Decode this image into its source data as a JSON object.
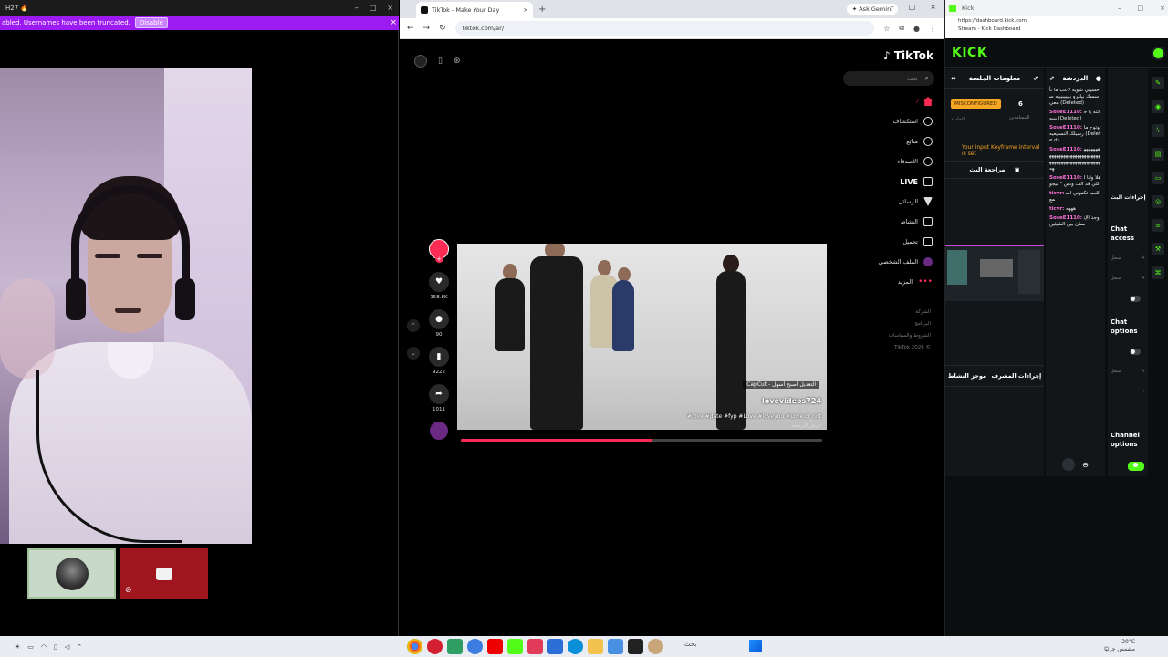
{
  "left_window": {
    "title": "H27 🔥",
    "banner_message": "abled. Usernames have been truncated.",
    "banner_button": "Disable",
    "banner_close": "×"
  },
  "browser": {
    "tab_title": "TikTok - Make Your Day",
    "tab_close": "×",
    "new_tab": "+",
    "gemini_label": "✦ Ask Gemini",
    "url": "tiktok.com/ar/",
    "window_controls": [
      "–",
      "□",
      "×"
    ]
  },
  "tiktok": {
    "logo": "♪ TikTok",
    "search_placeholder": "بحث",
    "nav": [
      {
        "label": "",
        "icon": "home"
      },
      {
        "label": "استكشاف",
        "icon": "compass"
      },
      {
        "label": "متابَع",
        "icon": "user"
      },
      {
        "label": "الأصدقاء",
        "icon": "friends"
      },
      {
        "label": "LIVE",
        "icon": "live"
      },
      {
        "label": "الرسائل",
        "icon": "messages"
      },
      {
        "label": "النشاط",
        "icon": "activity"
      },
      {
        "label": "تحميل",
        "icon": "upload"
      },
      {
        "label": "الملف الشخصي",
        "icon": "avatar"
      },
      {
        "label": "المزيد",
        "icon": "more"
      }
    ],
    "footer": [
      "الشركة",
      "البرنامج",
      "الشروط والسياسات",
      "TikTok 2026 ©"
    ],
    "likes": "158.8K",
    "comments": "90",
    "saves": "9222",
    "shares": "1011",
    "video_caption_badge": "CapCut - التعديل أصبح أسهل",
    "video_author": "lovevideos724",
    "video_hashtags": "#love #date #fyp #Love #loveyou #Love or not",
    "video_translation": "عرض الترجمة",
    "progress_fraction": 0.53,
    "accent_color": "#fe2c55"
  },
  "kick": {
    "title": "Kick",
    "url_line1": "https://dashboard.kick.com",
    "url_line2": "Stream - Kick Dashboard",
    "logo": "KICK",
    "session_title": "معلومات الجلسة",
    "status_badge": "MISCONFIGURED",
    "viewers": "6",
    "viewers_label": "المشاهدين",
    "session_label": "الجلسة",
    "keyframe_warning": "Your input Keyframe interval is set",
    "stream_review": "مراجعة البث",
    "chat_title": "الدردشة",
    "chat_messages": [
      {
        "user": "",
        "text": "حسيبي شوية لاعب ما تأسسك بيليرو ببيبيبيبيه سمعي (Deleted)"
      },
      {
        "user": "SoseE1110:",
        "text": "انته يا حبيبه (Deleted)"
      },
      {
        "user": "SoseE1110:",
        "text": "توتوح ما رسيلك النسليعيه (Delete d)"
      },
      {
        "user": "SoseE1110:",
        "text": "ههههههههههههههههههههههههههههههههههههههههههههههههههههه"
      },
      {
        "user": "SoseE1110:",
        "text": "هلا وانا اللي قد الف ونص ° تيجو"
      },
      {
        "user": "ticvr:",
        "text": "اللعبه تكفوني اسمع"
      },
      {
        "user": "ticvr:",
        "text": "هههه"
      },
      {
        "user": "SoseE1110:",
        "text": "أوجد الإنسان بين الشيئين"
      }
    ],
    "mod_actions": "إجراءات المشرف",
    "mod_activity": "موجز النشاط",
    "side_header": "إجراءات البث",
    "chat_access": "Chat access",
    "chat_options": "Chat options",
    "channel_options": "Channel options",
    "row_labels": [
      "سجل",
      "سجل",
      "سجل"
    ],
    "brand_color": "#53fc18",
    "warning_color": "#f5a623"
  },
  "taskbar": {
    "search_label": "بحث",
    "clock_line1": "30°C",
    "clock_line2": "مشمس جزئيًا"
  }
}
